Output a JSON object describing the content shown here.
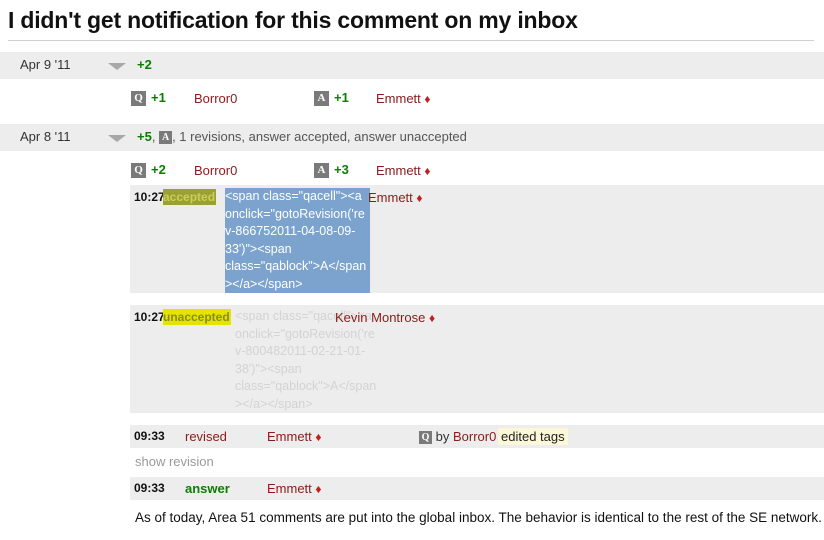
{
  "page": {
    "title": "I didn't get notification for this comment on my inbox"
  },
  "days": [
    {
      "date": "Apr 9 '11",
      "summary_votes": "+2",
      "summary_rest": "",
      "chevron_icon": "chevron-down-icon"
    },
    {
      "date": "Apr 8 '11",
      "summary_votes": "+5",
      "summary_rest": ", 1 revisions, answer accepted, answer unaccepted",
      "chevron_icon": "chevron-down-icon"
    }
  ],
  "votes": [
    {
      "q_badge": "Q",
      "q_count": "+1",
      "q_user": "Borror0",
      "a_badge": "A",
      "a_count": "+1",
      "a_user": "Emmett",
      "diamond": "♦"
    },
    {
      "q_badge": "Q",
      "q_count": "+2",
      "q_user": "Borror0",
      "a_badge": "A",
      "a_count": "+3",
      "a_user": "Emmett",
      "diamond": "♦"
    }
  ],
  "events": [
    {
      "time": "10:27",
      "tag": "accepted",
      "code": "<span class=\"qacell\"><a onclick=\"gotoRevision('rev-866752011-04-08-09-33')\"><span class=\"qablock\">A</span></a></span>",
      "user": "Emmett",
      "diamond": "♦",
      "selected": true
    },
    {
      "time": "10:27",
      "tag": "unaccepted",
      "code": "<span class=\"qacell\"><a onclick=\"gotoRevision('rev-800482011-02-21-01-38')\"><span class=\"qablock\">A</span></a></span>",
      "user": "Kevin Montrose",
      "diamond": "♦",
      "selected": false
    }
  ],
  "revised": {
    "time": "09:33",
    "action": "revised",
    "user": "Emmett",
    "diamond": "♦",
    "badge": "Q",
    "by_label": "by",
    "by_user": "Borror0",
    "tags": "edited tags",
    "show_revision": "show revision"
  },
  "answer": {
    "time": "09:33",
    "action": "answer",
    "user": "Emmett",
    "diamond": "♦",
    "body": "As of today, Area 51 comments are put into the global inbox. The behavior is identical to the rest of the SE network."
  },
  "inline_badge": "A",
  "colors": {
    "vote_green": "#0a8000",
    "user_red": "#8b1a1a",
    "row_gray": "#ededed",
    "selection_blue": "#7ba3ce",
    "highlight_yellow": "#e4e400",
    "tag_highlight": "#fbf7d7"
  }
}
